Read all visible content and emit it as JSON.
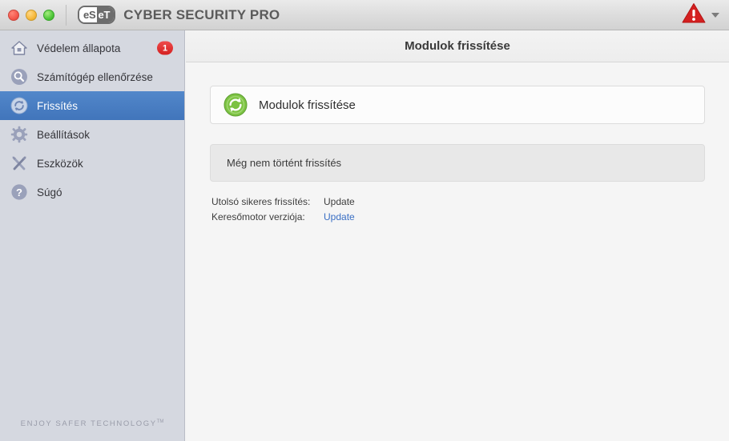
{
  "titlebar": {
    "window_controls": [
      "close",
      "minimize",
      "zoom"
    ],
    "logo_left": "eS",
    "logo_right": "eT",
    "brand": "CYBER SECURITY PRO",
    "status_icon": "warning-triangle-icon",
    "status_color": "#d42020",
    "dropdown_icon": "chevron-down-icon"
  },
  "sidebar": {
    "items": [
      {
        "label": "Védelem állapota",
        "icon": "home-icon",
        "badge": "1",
        "selected": false
      },
      {
        "label": "Számítógép ellenőrzése",
        "icon": "magnifier-icon",
        "badge": "",
        "selected": false
      },
      {
        "label": "Frissítés",
        "icon": "refresh-icon",
        "badge": "",
        "selected": true
      },
      {
        "label": "Beállítások",
        "icon": "gear-icon",
        "badge": "",
        "selected": false
      },
      {
        "label": "Eszközök",
        "icon": "tools-icon",
        "badge": "",
        "selected": false
      },
      {
        "label": "Súgó",
        "icon": "question-icon",
        "badge": "",
        "selected": false
      }
    ],
    "tagline": "ENJOY SAFER TECHNOLOGY",
    "tagline_tm": "TM",
    "selected_color": "#4175bb",
    "background_color": "#d5d8e0"
  },
  "content": {
    "header_title": "Modulok frissítése",
    "card": {
      "icon": "green-refresh-icon",
      "icon_color": "#6cb33f",
      "label": "Modulok frissítése"
    },
    "status": {
      "text": "Még nem történt frissítés"
    },
    "info": [
      {
        "key": "Utolsó sikeres frissítés:",
        "value": "Update",
        "is_link": false
      },
      {
        "key": "Keresőmotor verziója:",
        "value": "Update",
        "is_link": true
      }
    ],
    "link_color": "#3a6fc4"
  }
}
